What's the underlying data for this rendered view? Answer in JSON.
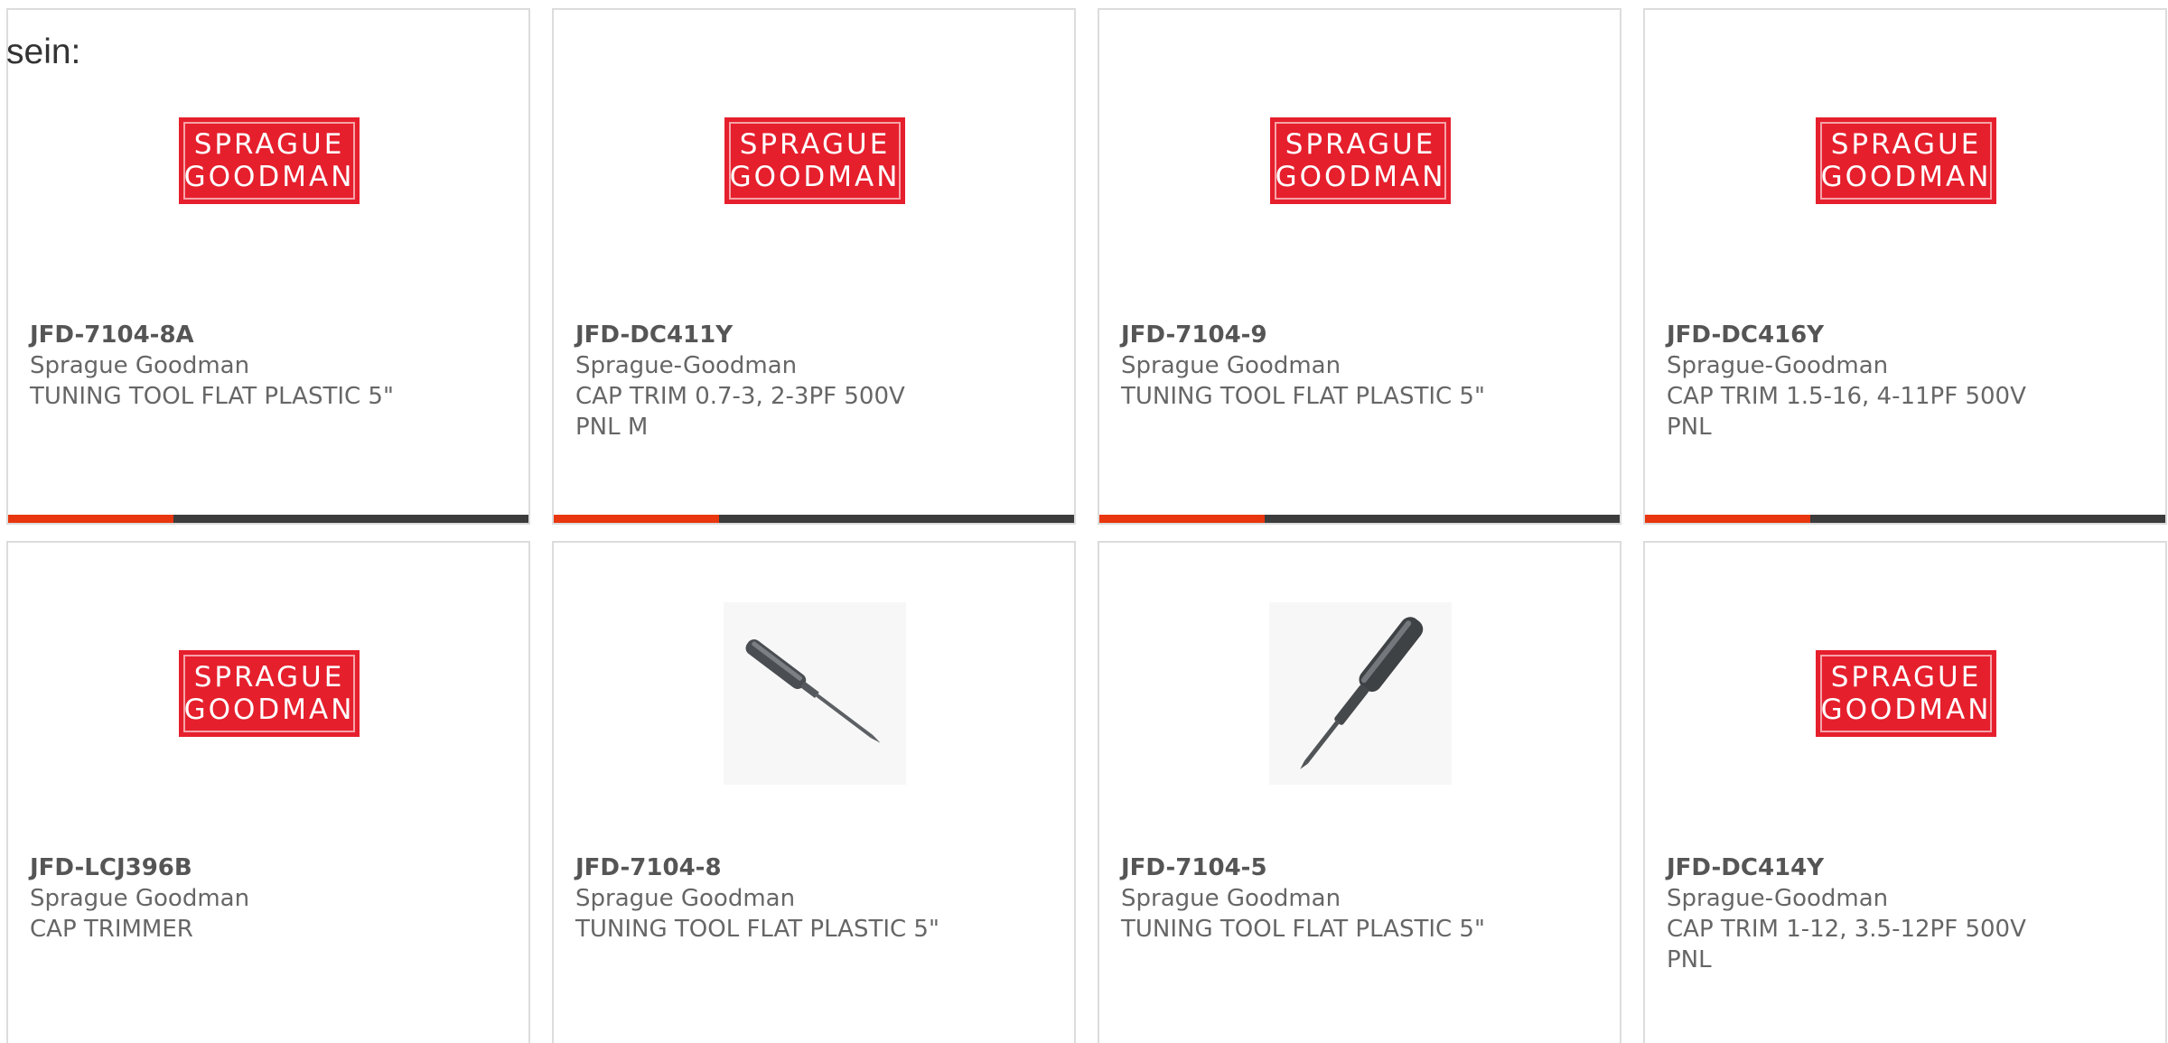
{
  "intro_text": "sein:",
  "colors": {
    "accent": "#e8360e",
    "bar": "#3c3c3c",
    "logo_red": "#e61f2d"
  },
  "products": [
    {
      "part": "JFD-7104-8A",
      "brand": "Sprague Goodman",
      "desc": "TUNING TOOL FLAT PLASTIC 5\"",
      "image": "sprague-goodman-logo",
      "logo_line1": "SPRAGUE",
      "logo_line2": "GOODMAN"
    },
    {
      "part": "JFD-DC411Y",
      "brand": "Sprague-Goodman",
      "desc": "CAP TRIM 0.7-3, 2-3PF 500V PNL M",
      "image": "sprague-goodman-logo",
      "logo_line1": "SPRAGUE",
      "logo_line2": "GOODMAN"
    },
    {
      "part": "JFD-7104-9",
      "brand": "Sprague Goodman",
      "desc": "TUNING TOOL FLAT PLASTIC 5\"",
      "image": "sprague-goodman-logo",
      "logo_line1": "SPRAGUE",
      "logo_line2": "GOODMAN"
    },
    {
      "part": "JFD-DC416Y",
      "brand": "Sprague-Goodman",
      "desc": "CAP TRIM 1.5-16, 4-11PF 500V PNL",
      "image": "sprague-goodman-logo",
      "logo_line1": "SPRAGUE",
      "logo_line2": "GOODMAN"
    },
    {
      "part": "JFD-LCJ396B",
      "brand": "Sprague Goodman",
      "desc": "CAP TRIMMER",
      "image": "sprague-goodman-logo",
      "logo_line1": "SPRAGUE",
      "logo_line2": "GOODMAN"
    },
    {
      "part": "JFD-7104-8",
      "brand": "Sprague Goodman",
      "desc": "TUNING TOOL FLAT PLASTIC 5\"",
      "image": "tuning-tool-photo-a"
    },
    {
      "part": "JFD-7104-5",
      "brand": "Sprague Goodman",
      "desc": "TUNING TOOL FLAT PLASTIC 5\"",
      "image": "tuning-tool-photo-b"
    },
    {
      "part": "JFD-DC414Y",
      "brand": "Sprague-Goodman",
      "desc": "CAP TRIM 1-12, 3.5-12PF 500V PNL",
      "image": "sprague-goodman-logo",
      "logo_line1": "SPRAGUE",
      "logo_line2": "GOODMAN"
    }
  ]
}
